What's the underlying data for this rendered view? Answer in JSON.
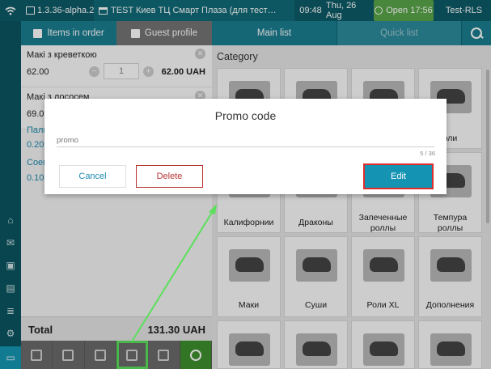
{
  "topbar": {
    "version": "1.3.36-alpha.2",
    "store": "TEST Киев ТЦ Смарт Плаза (для тест…",
    "time": "09:48",
    "date": "Thu, 26 Aug",
    "shift": "Open 17:56",
    "user": "Test-RLS"
  },
  "order_panel": {
    "tab_items": "Items in order",
    "tab_guest": "Guest profile",
    "items": [
      {
        "name": "Макі з креветкою",
        "price": "62.00",
        "qty": "1",
        "sum": "62.00 UAH"
      },
      {
        "name": "Макі з лососем",
        "price": "69.0"
      }
    ],
    "partial": [
      "Пали",
      "0.20",
      "Соев",
      "0.10"
    ],
    "total_label": "Total",
    "total_value": "131.30 UAH"
  },
  "menu_panel": {
    "tab_main": "Main list",
    "tab_quick": "Quick list",
    "category_title": "Category",
    "tiles": [
      "",
      "",
      "",
      "оли",
      "Калифорнии",
      "Драконы",
      "Запеченные роллы",
      "Темпура роллы",
      "Маки",
      "Суши",
      "Роли XL",
      "Дополнения",
      "",
      "",
      "",
      ""
    ]
  },
  "modal": {
    "title": "Promo code",
    "placeholder": "promo",
    "counter": "5 / 36",
    "cancel": "Cancel",
    "delete": "Delete",
    "edit": "Edit"
  },
  "colors": {
    "topbar": "#0d5b67",
    "accent": "#1b7e90",
    "shift_open": "#5aa64a",
    "danger": "#b73333",
    "highlight_green": "#5be05b"
  },
  "icons": {
    "rail": [
      "home-icon",
      "mail-icon",
      "document-add-icon",
      "building-icon",
      "list-icon",
      "gear-icon",
      "keyboard-icon"
    ],
    "actions": [
      "trash-icon",
      "chat-icon",
      "alarm-icon",
      "chart-icon",
      "bike-icon",
      "refresh-icon"
    ]
  }
}
